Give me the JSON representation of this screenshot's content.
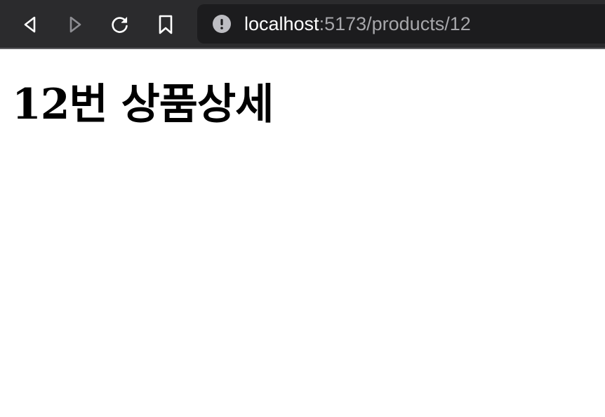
{
  "toolbar": {
    "back_icon": "back-arrow-icon",
    "forward_icon": "forward-arrow-icon",
    "reload_icon": "reload-icon",
    "bookmark_icon": "bookmark-icon",
    "info_icon": "info-icon",
    "url_host": "localhost",
    "url_rest": ":5173/products/12",
    "colors": {
      "toolbar_bg": "#2b2b2d",
      "address_bg": "#1c1c1e",
      "icon_active": "#ffffff",
      "icon_disabled": "#8e8e93"
    }
  },
  "page": {
    "title": "12번 상품상세"
  }
}
